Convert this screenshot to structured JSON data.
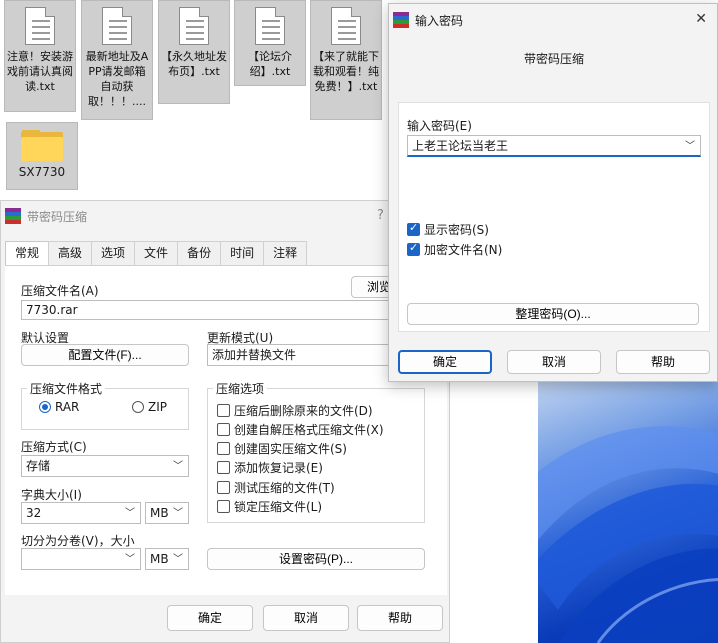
{
  "desktop": {
    "files": [
      {
        "name": "注意！安装游戏前请认真阅读.txt"
      },
      {
        "name": "最新地址及APP请发邮箱自动获取！！！...."
      },
      {
        "name": "【永久地址发布页】.txt"
      },
      {
        "name": "【论坛介绍】.txt"
      },
      {
        "name": "【来了就能下载和观看！纯免费！】.txt"
      }
    ],
    "folder": {
      "name": "SX7730"
    }
  },
  "archive_dialog": {
    "title": "带密码压缩",
    "help": "?",
    "tabs": [
      "常规",
      "高级",
      "选项",
      "文件",
      "备份",
      "时间",
      "注释"
    ],
    "archive_name_label": "压缩文件名(A)",
    "archive_name_value": "7730.rar",
    "browse_button": "浏览(",
    "default_profile_label": "默认设置",
    "profiles_button": "配置文件(F)...",
    "update_mode_label": "更新模式(U)",
    "update_mode_value": "添加并替换文件",
    "format_group_title": "压缩文件格式",
    "format_rar": "RAR",
    "format_zip": "ZIP",
    "options_group_title": "压缩选项",
    "options": [
      {
        "label": "压缩后删除原来的文件(D)",
        "checked": false
      },
      {
        "label": "创建自解压格式压缩文件(X)",
        "checked": false
      },
      {
        "label": "创建固实压缩文件(S)",
        "checked": false
      },
      {
        "label": "添加恢复记录(E)",
        "checked": false
      },
      {
        "label": "测试压缩的文件(T)",
        "checked": false
      },
      {
        "label": "锁定压缩文件(L)",
        "checked": false
      }
    ],
    "method_label": "压缩方式(C)",
    "method_value": "存储",
    "dict_label": "字典大小(I)",
    "dict_value": "32",
    "dict_unit": "MB",
    "split_label": "切分为分卷(V)，大小",
    "split_value": "",
    "split_unit": "MB",
    "set_password_button": "设置密码(P)...",
    "ok_button": "确定",
    "cancel_button": "取消",
    "help_button": "帮助"
  },
  "password_dialog": {
    "title": "输入密码",
    "heading": "带密码压缩",
    "password_label": "输入密码(E)",
    "password_value": "上老王论坛当老王",
    "show_password": {
      "label": "显示密码(S)",
      "checked": true
    },
    "encrypt_names": {
      "label": "加密文件名(N)",
      "checked": true
    },
    "organize_button": "整理密码(O)...",
    "ok_button": "确定",
    "cancel_button": "取消",
    "help_button": "帮助"
  },
  "colors": {
    "accent": "#1b64c8",
    "folder": "#ffd55a"
  }
}
